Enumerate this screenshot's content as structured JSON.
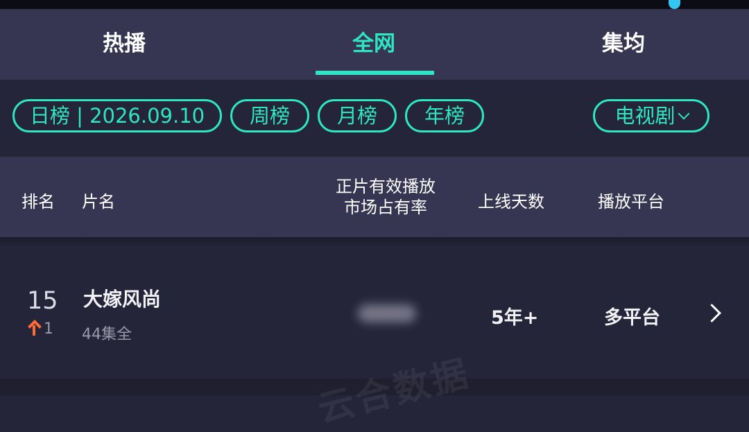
{
  "tabs": [
    {
      "label": "热播",
      "active": false
    },
    {
      "label": "全网",
      "active": true
    },
    {
      "label": "集均",
      "active": false
    }
  ],
  "colors": {
    "accent": "#2ee6c1",
    "background": "#25253a",
    "panel": "#363652",
    "rank_up": "#ff6a35"
  },
  "filters": {
    "daily": "日榜 | 2026.09.10",
    "weekly": "周榜",
    "monthly": "月榜",
    "yearly": "年榜",
    "category": "电视剧"
  },
  "columns": {
    "rank": "排名",
    "title": "片名",
    "share_line1": "正片有效播放",
    "share_line2": "市场占有率",
    "days": "上线天数",
    "platform": "播放平台"
  },
  "rows": [
    {
      "rank": "15",
      "rank_change": "1",
      "rank_change_direction": "up",
      "title": "大嫁风尚",
      "episodes": "44集全",
      "days_online": "5年+",
      "platform": "多平台"
    }
  ],
  "watermark": "云合数据"
}
